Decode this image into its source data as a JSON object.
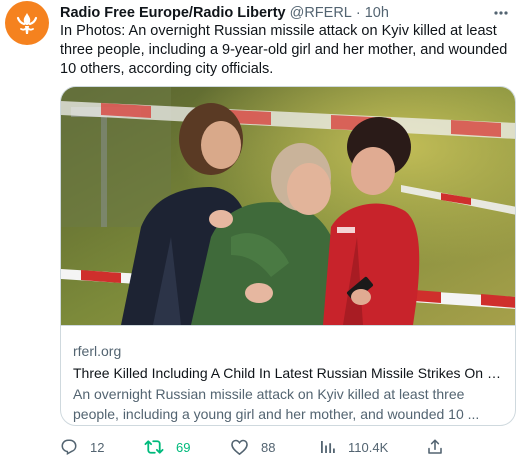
{
  "tweet": {
    "author": {
      "display_name": "Radio Free Europe/Radio Liberty",
      "handle": "@RFERL",
      "separator": "·",
      "time": "10h",
      "avatar_icon": "rferl-torch-logo-icon",
      "avatar_color": "#f5821f"
    },
    "text": "In Photos: An overnight Russian missile attack on Kyiv killed at least three people, including a 9-year-old girl and her mother, and wounded 10 others, according city officials.",
    "card": {
      "image_alt": "Mourning women embracing near red and white barrier tape",
      "domain": "rferl.org",
      "title": "Three Killed Including A Child In Latest Russian Missile Strikes On Kyiv",
      "description": "An overnight Russian missile attack on Kyiv killed at least three people, including a young girl and her mother, and wounded 10 ..."
    },
    "actions": {
      "reply": {
        "icon": "reply-icon",
        "count": "12"
      },
      "retweet": {
        "icon": "retweet-icon",
        "count": "69",
        "color": "#00ba7c"
      },
      "like": {
        "icon": "heart-icon",
        "count": "88"
      },
      "views": {
        "icon": "views-icon",
        "count": "110.4K"
      },
      "share": {
        "icon": "share-icon"
      }
    },
    "more_icon": "more-icon"
  }
}
